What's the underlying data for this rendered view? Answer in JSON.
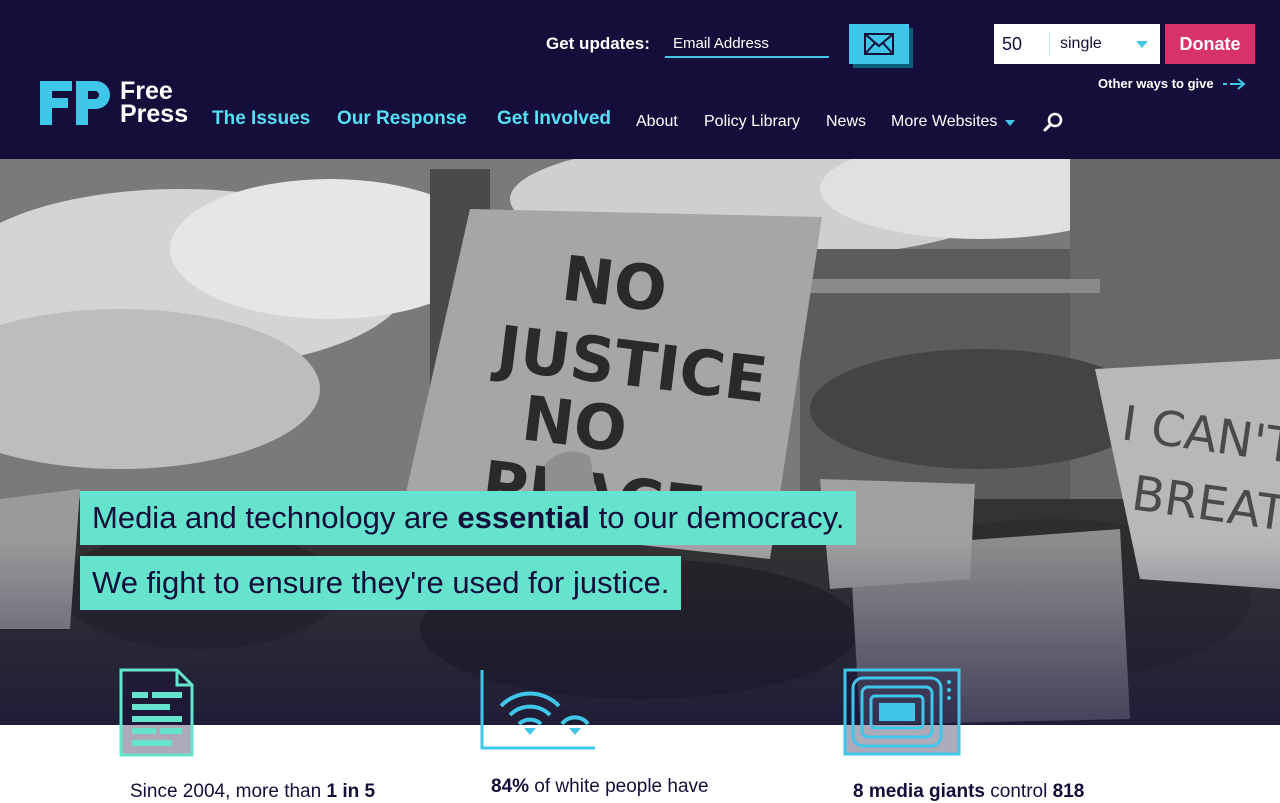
{
  "header": {
    "updates_label": "Get updates:",
    "email_placeholder": "Email Address",
    "donation": {
      "amount": "50",
      "frequency": "single",
      "donate_label": "Donate",
      "other_ways_label": "Other ways to give"
    },
    "logo": {
      "line1": "Free",
      "line2": "Press"
    },
    "nav_main": [
      "The Issues",
      "Our Response",
      "Get Involved"
    ],
    "nav_secondary": [
      "About",
      "Policy Library",
      "News",
      "More Websites"
    ]
  },
  "hero": {
    "headline1_pre": "Media and technology are ",
    "headline1_bold": "essential",
    "headline1_post": " to our democracy.",
    "headline2": "We fight to ensure they're used for justice."
  },
  "stats": [
    {
      "pre": "Since 2004, more than ",
      "bold": "1 in 5",
      "post": ""
    },
    {
      "pre": "",
      "bold": "84%",
      "post": " of white people have"
    },
    {
      "pre": "",
      "bold": "8 media giants",
      "post": " control ",
      "bold2": "818"
    }
  ],
  "colors": {
    "navy": "#150e3a",
    "cyan": "#3fc6e8",
    "nav_cyan": "#56e0f5",
    "mint": "#65e3cc",
    "donate_pink": "#d8326b"
  },
  "icons": [
    "mail-icon",
    "search-icon",
    "arrow-right-icon",
    "document-icon",
    "wifi-icon",
    "tv-icon",
    "fp-logo-icon"
  ]
}
